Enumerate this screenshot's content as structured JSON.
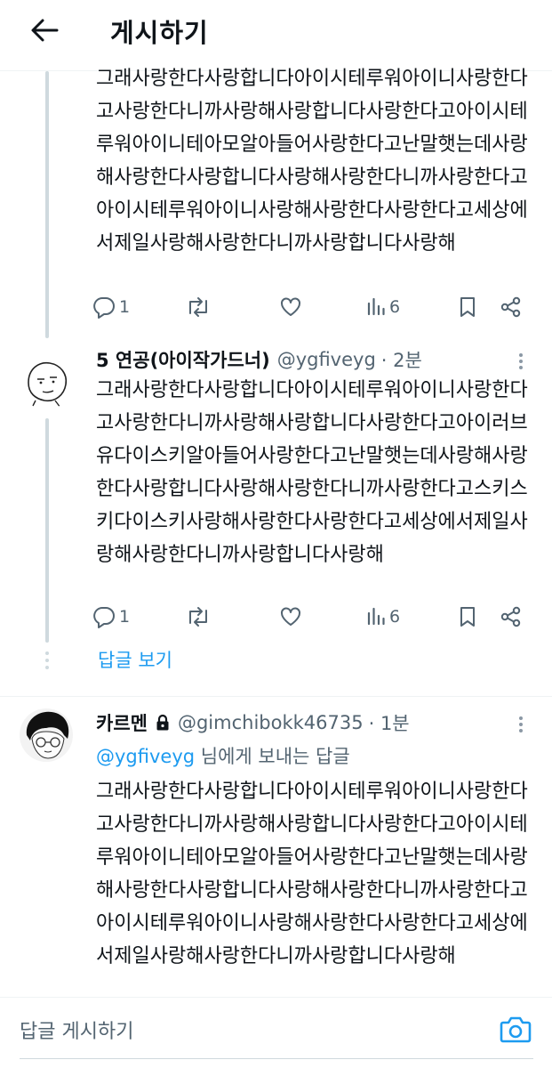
{
  "header": {
    "title": "게시하기"
  },
  "tweets": [
    {
      "text": "그래사랑한다사랑합니다아이시테루워아이니사랑한다고사랑한다니까사랑해사랑합니다사랑한다고아이시테루워아이니테아모알아들어사랑한다고난말햇는데사랑해사랑한다사랑합니다사랑해사랑한다니까사랑한다고아이시테루워아이니사랑해사랑한다사랑한다고세상에서제일사랑해사랑한다니까사랑합니다사랑해",
      "actions": {
        "replies": "1",
        "retweets": "",
        "likes": "",
        "views": "6"
      }
    },
    {
      "name": "5 연공(아이작가드너)",
      "handle": "@ygfiveyg",
      "time": "· 2분",
      "text": "그래사랑한다사랑합니다아이시테루워아이니사랑한다고사랑한다니까사랑해사랑합니다사랑한다고아이러브유다이스키알아들어사랑한다고난말햇는데사랑해사랑한다사랑합니다사랑해사랑한다니까사랑한다고스키스키다이스키사랑해사랑한다사랑한다고세상에서제일사랑해사랑한다니까사랑합니다사랑해",
      "actions": {
        "replies": "1",
        "retweets": "",
        "likes": "",
        "views": "6"
      },
      "show_replies": "답글 보기"
    },
    {
      "name": "카르멘",
      "handle": "@gimchibokk46735",
      "time": "· 1분",
      "reply_to_mention": "@ygfiveyg",
      "reply_to_suffix": " 님에게 보내는 답글",
      "text": "그래사랑한다사랑합니다아이시테루워아이니사랑한다고사랑한다니까사랑해사랑합니다사랑한다고아이시테루워아이니테아모알아들어사랑한다고난말햇는데사랑해사랑한다사랑합니다사랑해사랑한다니까사랑한다고아이시테루워아이니사랑해사랑한다사랑한다고세상에서제일사랑해사랑한다니까사랑합니다사랑해"
    }
  ],
  "compose": {
    "placeholder": "답글 게시하기"
  },
  "colors": {
    "accent": "#1d9bf0",
    "secondary_text": "#536471",
    "thread_line": "#cfd9de"
  },
  "icons": [
    "back-arrow-icon",
    "reply-icon",
    "retweet-icon",
    "like-icon",
    "views-icon",
    "bookmark-icon",
    "share-icon",
    "more-icon",
    "lock-icon",
    "camera-icon"
  ]
}
